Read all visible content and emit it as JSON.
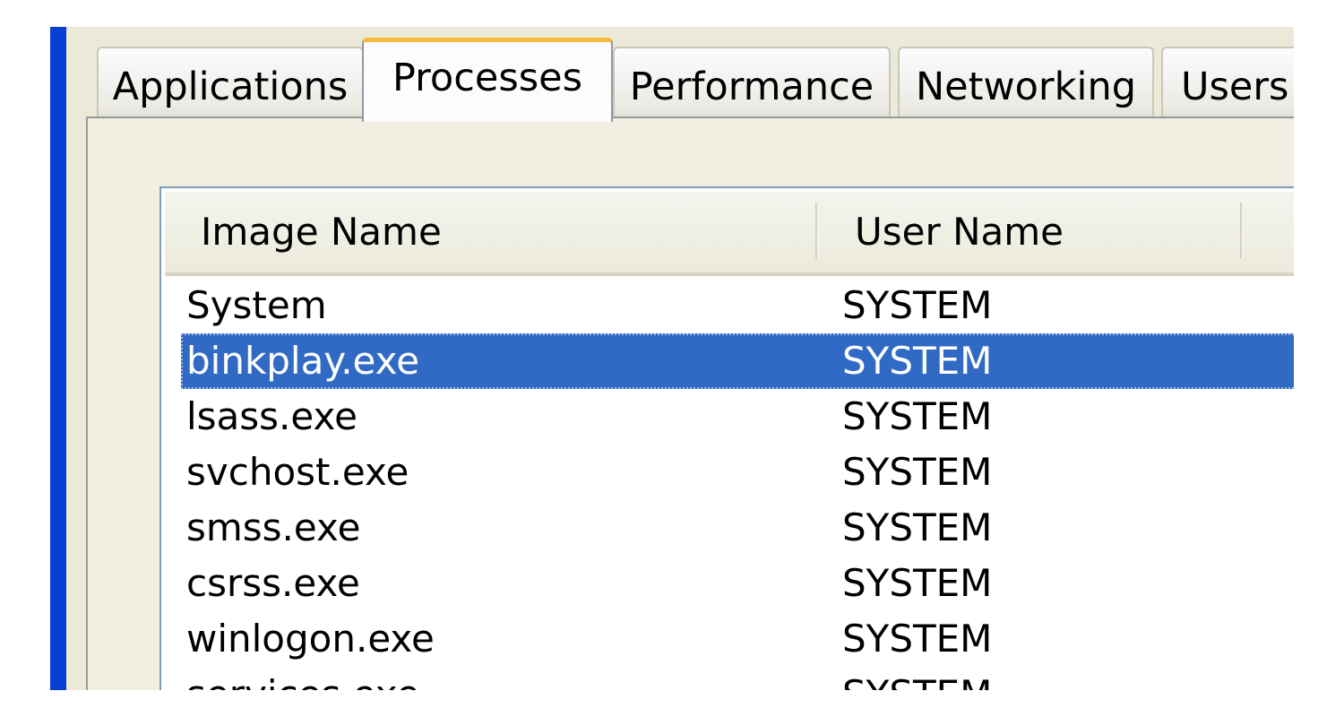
{
  "tabs": [
    {
      "label": "Applications",
      "active": false
    },
    {
      "label": "Processes",
      "active": true
    },
    {
      "label": "Performance",
      "active": false
    },
    {
      "label": "Networking",
      "active": false
    },
    {
      "label": "Users",
      "active": false
    }
  ],
  "processes": {
    "columns": {
      "image_name": "Image Name",
      "user_name": "User Name"
    },
    "selected_index": 1,
    "rows": [
      {
        "image_name": "System",
        "user_name": "SYSTEM"
      },
      {
        "image_name": "binkplay.exe",
        "user_name": "SYSTEM"
      },
      {
        "image_name": "lsass.exe",
        "user_name": "SYSTEM"
      },
      {
        "image_name": "svchost.exe",
        "user_name": "SYSTEM"
      },
      {
        "image_name": "smss.exe",
        "user_name": "SYSTEM"
      },
      {
        "image_name": "csrss.exe",
        "user_name": "SYSTEM"
      },
      {
        "image_name": "winlogon.exe",
        "user_name": "SYSTEM"
      },
      {
        "image_name": "services.exe",
        "user_name": "SYSTEM"
      }
    ]
  },
  "colors": {
    "selection": "#316ac5",
    "active_tab_accent": "#f7b93d",
    "window_border": "#0a3fd6",
    "dialog_background": "#ece9d8"
  }
}
